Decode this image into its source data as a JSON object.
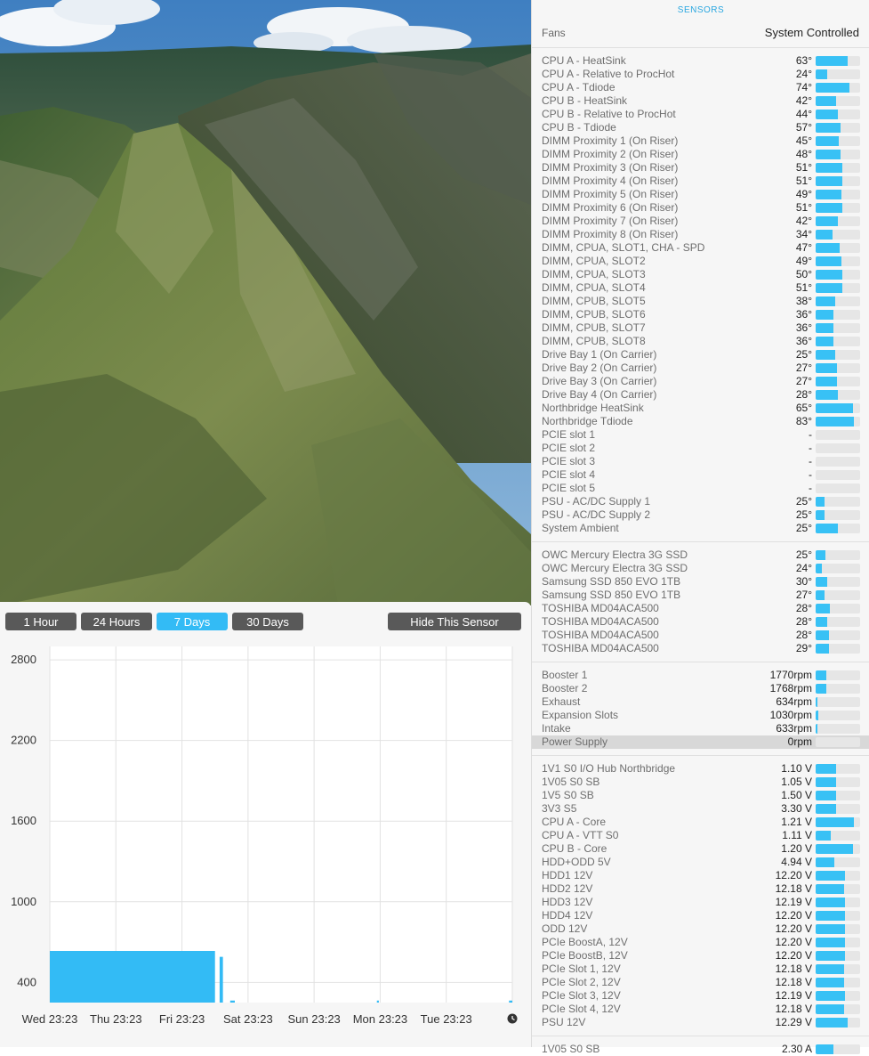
{
  "panel": {
    "title": "SENSORS",
    "fans_label": "Fans",
    "fans_mode": "System Controlled",
    "groups": [
      {
        "rows": [
          {
            "name": "CPU A - HeatSink",
            "value": "63°",
            "level": 0.72
          },
          {
            "name": "CPU A - Relative to ProcHot",
            "value": "24°",
            "level": 0.26
          },
          {
            "name": "CPU A - Tdiode",
            "value": "74°",
            "level": 0.76
          },
          {
            "name": "CPU B - HeatSink",
            "value": "42°",
            "level": 0.46
          },
          {
            "name": "CPU B - Relative to ProcHot",
            "value": "44°",
            "level": 0.5
          },
          {
            "name": "CPU B - Tdiode",
            "value": "57°",
            "level": 0.56
          },
          {
            "name": "DIMM Proximity 1 (On Riser)",
            "value": "45°",
            "level": 0.52
          },
          {
            "name": "DIMM Proximity 2 (On Riser)",
            "value": "48°",
            "level": 0.56
          },
          {
            "name": "DIMM Proximity 3 (On Riser)",
            "value": "51°",
            "level": 0.6
          },
          {
            "name": "DIMM Proximity 4 (On Riser)",
            "value": "51°",
            "level": 0.6
          },
          {
            "name": "DIMM Proximity 5 (On Riser)",
            "value": "49°",
            "level": 0.58
          },
          {
            "name": "DIMM Proximity 6 (On Riser)",
            "value": "51°",
            "level": 0.6
          },
          {
            "name": "DIMM Proximity 7 (On Riser)",
            "value": "42°",
            "level": 0.5
          },
          {
            "name": "DIMM Proximity 8 (On Riser)",
            "value": "34°",
            "level": 0.38
          },
          {
            "name": "DIMM, CPUA, SLOT1, CHA - SPD",
            "value": "47°",
            "level": 0.54
          },
          {
            "name": "DIMM, CPUA, SLOT2",
            "value": "49°",
            "level": 0.58
          },
          {
            "name": "DIMM, CPUA, SLOT3",
            "value": "50°",
            "level": 0.6
          },
          {
            "name": "DIMM, CPUA, SLOT4",
            "value": "51°",
            "level": 0.6
          },
          {
            "name": "DIMM, CPUB, SLOT5",
            "value": "38°",
            "level": 0.44
          },
          {
            "name": "DIMM, CPUB, SLOT6",
            "value": "36°",
            "level": 0.4
          },
          {
            "name": "DIMM, CPUB, SLOT7",
            "value": "36°",
            "level": 0.4
          },
          {
            "name": "DIMM, CPUB, SLOT8",
            "value": "36°",
            "level": 0.4
          },
          {
            "name": "Drive Bay 1 (On Carrier)",
            "value": "25°",
            "level": 0.44
          },
          {
            "name": "Drive Bay 2 (On Carrier)",
            "value": "27°",
            "level": 0.48
          },
          {
            "name": "Drive Bay 3 (On Carrier)",
            "value": "27°",
            "level": 0.48
          },
          {
            "name": "Drive Bay 4 (On Carrier)",
            "value": "28°",
            "level": 0.5
          },
          {
            "name": "Northbridge HeatSink",
            "value": "65°",
            "level": 0.84
          },
          {
            "name": "Northbridge Tdiode",
            "value": "83°",
            "level": 0.86
          },
          {
            "name": "PCIE slot 1",
            "value": "-",
            "level": 0
          },
          {
            "name": "PCIE slot 2",
            "value": "-",
            "level": 0
          },
          {
            "name": "PCIE slot 3",
            "value": "-",
            "level": 0
          },
          {
            "name": "PCIE slot 4",
            "value": "-",
            "level": 0
          },
          {
            "name": "PCIE slot 5",
            "value": "-",
            "level": 0
          },
          {
            "name": "PSU - AC/DC Supply 1",
            "value": "25°",
            "level": 0.2
          },
          {
            "name": "PSU - AC/DC Supply 2",
            "value": "25°",
            "level": 0.2
          },
          {
            "name": "System Ambient",
            "value": "25°",
            "level": 0.5
          }
        ]
      },
      {
        "rows": [
          {
            "name": "OWC Mercury Electra 3G SSD",
            "value": "25°",
            "level": 0.22
          },
          {
            "name": "OWC Mercury Electra 3G SSD",
            "value": "24°",
            "level": 0.14
          },
          {
            "name": "Samsung SSD 850 EVO 1TB",
            "value": "30°",
            "level": 0.26
          },
          {
            "name": "Samsung SSD 850 EVO 1TB",
            "value": "27°",
            "level": 0.2
          },
          {
            "name": "TOSHIBA MD04ACA500",
            "value": "28°",
            "level": 0.32
          },
          {
            "name": "TOSHIBA MD04ACA500",
            "value": "28°",
            "level": 0.26
          },
          {
            "name": "TOSHIBA MD04ACA500",
            "value": "28°",
            "level": 0.3
          },
          {
            "name": "TOSHIBA MD04ACA500",
            "value": "29°",
            "level": 0.3
          }
        ]
      },
      {
        "rows": [
          {
            "name": "Booster 1",
            "value": "1770rpm",
            "level": 0.24
          },
          {
            "name": "Booster 2",
            "value": "1768rpm",
            "level": 0.24
          },
          {
            "name": "Exhaust",
            "value": "634rpm",
            "level": 0.04
          },
          {
            "name": "Expansion Slots",
            "value": "1030rpm",
            "level": 0.06
          },
          {
            "name": "Intake",
            "value": "633rpm",
            "level": 0.04
          },
          {
            "name": "Power Supply",
            "value": "0rpm",
            "level": 0,
            "highlight": true
          }
        ]
      },
      {
        "rows": [
          {
            "name": "1V1 S0 I/O Hub Northbridge",
            "value": "1.10 V",
            "level": 0.46
          },
          {
            "name": "1V05 S0 SB",
            "value": "1.05 V",
            "level": 0.46
          },
          {
            "name": "1V5 S0 SB",
            "value": "1.50 V",
            "level": 0.46
          },
          {
            "name": "3V3 S5",
            "value": "3.30 V",
            "level": 0.46
          },
          {
            "name": "CPU A - Core",
            "value": "1.21 V",
            "level": 0.86
          },
          {
            "name": "CPU A - VTT S0",
            "value": "1.11 V",
            "level": 0.34
          },
          {
            "name": "CPU B - Core",
            "value": "1.20 V",
            "level": 0.84
          },
          {
            "name": "HDD+ODD 5V",
            "value": "4.94 V",
            "level": 0.42
          },
          {
            "name": "HDD1 12V",
            "value": "12.20 V",
            "level": 0.66
          },
          {
            "name": "HDD2 12V",
            "value": "12.18 V",
            "level": 0.64
          },
          {
            "name": "HDD3 12V",
            "value": "12.19 V",
            "level": 0.65
          },
          {
            "name": "HDD4 12V",
            "value": "12.20 V",
            "level": 0.66
          },
          {
            "name": "ODD 12V",
            "value": "12.20 V",
            "level": 0.66
          },
          {
            "name": "PCIe BoostA, 12V",
            "value": "12.20 V",
            "level": 0.66
          },
          {
            "name": "PCIe BoostB, 12V",
            "value": "12.20 V",
            "level": 0.66
          },
          {
            "name": "PCIe Slot 1, 12V",
            "value": "12.18 V",
            "level": 0.64
          },
          {
            "name": "PCIe Slot 2, 12V",
            "value": "12.18 V",
            "level": 0.64
          },
          {
            "name": "PCIe Slot 3, 12V",
            "value": "12.19 V",
            "level": 0.65
          },
          {
            "name": "PCIe Slot 4, 12V",
            "value": "12.18 V",
            "level": 0.64
          },
          {
            "name": "PSU 12V",
            "value": "12.29 V",
            "level": 0.72
          }
        ]
      },
      {
        "rows": [
          {
            "name": "1V05 S0 SB",
            "value": "2.30 A",
            "level": 0.4
          }
        ]
      }
    ]
  },
  "chart_window": {
    "range_buttons": [
      {
        "label": "1 Hour",
        "active": false
      },
      {
        "label": "24 Hours",
        "active": false
      },
      {
        "label": "7 Days",
        "active": true
      },
      {
        "label": "30 Days",
        "active": false
      }
    ],
    "hide_button": "Hide This Sensor",
    "clock_icon": "clock-icon"
  },
  "chart_data": {
    "type": "area",
    "title": "",
    "xlabel": "",
    "ylabel": "",
    "ylim": [
      250,
      2900
    ],
    "y_ticks": [
      400,
      1000,
      1600,
      2200,
      2800
    ],
    "x_ticks": [
      "Wed 23:23",
      "Thu 23:23",
      "Fri 23:23",
      "Sat 23:23",
      "Sun 23:23",
      "Mon 23:23",
      "Tue 23:23"
    ],
    "grid": true,
    "color": "#33bbf5",
    "series": [
      {
        "segments": [
          {
            "x": [
              0,
              2.5
            ],
            "y": [
              634,
              634
            ]
          },
          {
            "x": [
              2.57,
              2.62
            ],
            "y": [
              590,
              590
            ]
          },
          {
            "x": [
              2.73,
              2.8
            ],
            "y": [
              265,
              265
            ]
          },
          {
            "x": [
              4.95,
              4.98
            ],
            "y": [
              265,
              265
            ]
          },
          {
            "x": [
              6.95,
              7.0
            ],
            "y": [
              265,
              265
            ]
          }
        ]
      }
    ]
  }
}
